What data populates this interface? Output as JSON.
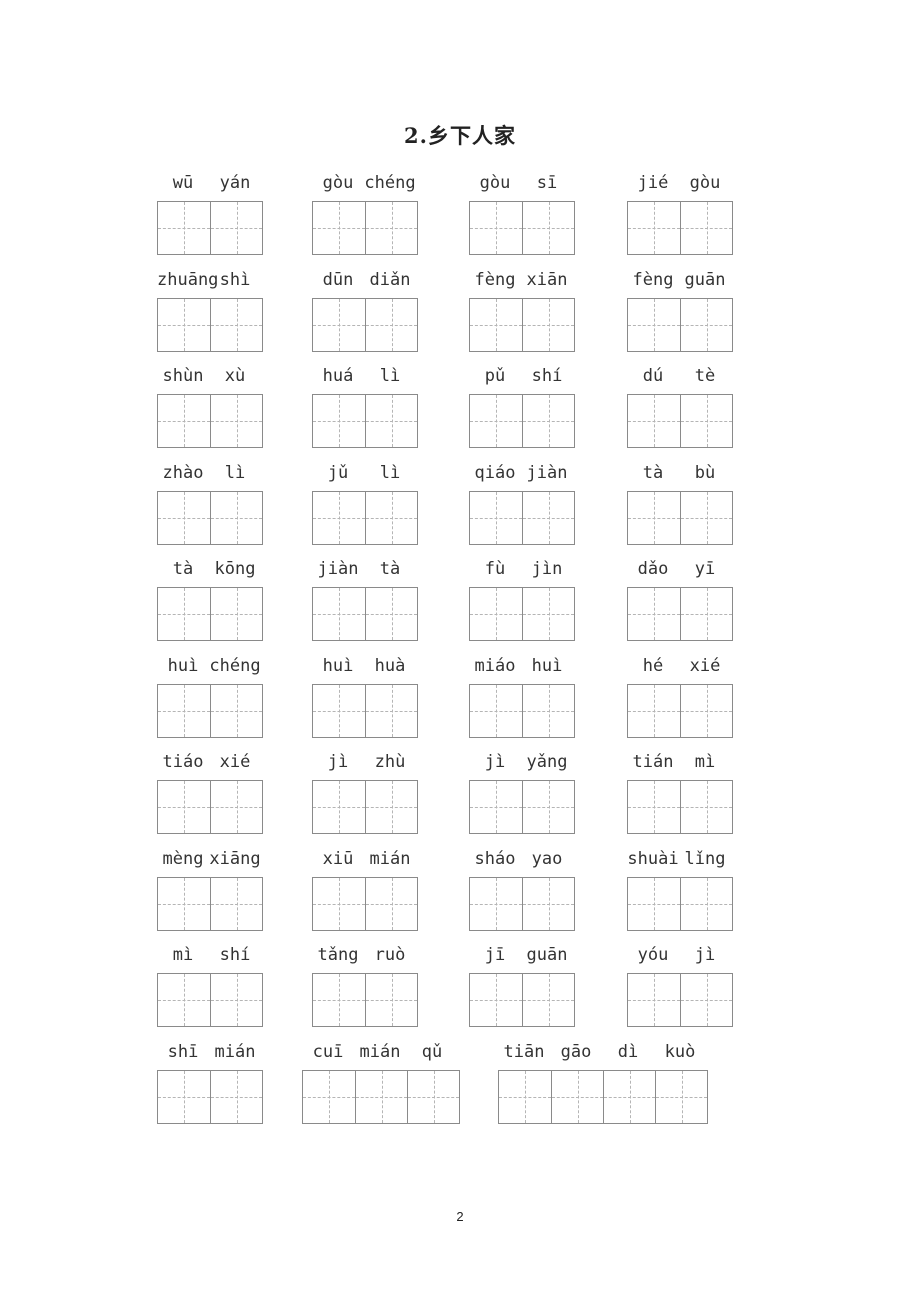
{
  "title": "2.乡下人家",
  "rows": [
    [
      [
        "wū",
        "yán"
      ],
      [
        "gòu",
        "chéng"
      ],
      [
        "gòu",
        "sī"
      ],
      [
        "jié",
        "gòu"
      ]
    ],
    [
      [
        "zhuāng",
        "shì"
      ],
      [
        "dūn",
        "diǎn"
      ],
      [
        "fèng",
        "xiān"
      ],
      [
        "fèng",
        "guān"
      ]
    ],
    [
      [
        "shùn",
        "xù"
      ],
      [
        "huá",
        "lì"
      ],
      [
        "pǔ",
        "shí"
      ],
      [
        "dú",
        "tè"
      ]
    ],
    [
      [
        "zhào",
        "lì"
      ],
      [
        "jǔ",
        "lì"
      ],
      [
        "qiáo",
        "jiàn"
      ],
      [
        "tà",
        "bù"
      ]
    ],
    [
      [
        "tà",
        "kōng"
      ],
      [
        "jiàn",
        "tà"
      ],
      [
        "fù",
        "jìn"
      ],
      [
        "dǎo",
        "yī"
      ]
    ],
    [
      [
        "huì",
        "chéng"
      ],
      [
        "huì",
        "huà"
      ],
      [
        "miáo",
        "huì"
      ],
      [
        "hé",
        "xié"
      ]
    ],
    [
      [
        "tiáo",
        "xié"
      ],
      [
        "jì",
        "zhù"
      ],
      [
        "jì",
        "yǎng"
      ],
      [
        "tián",
        "mì"
      ]
    ],
    [
      [
        "mèng",
        "xiāng"
      ],
      [
        "xiū",
        "mián"
      ],
      [
        "sháo",
        "yao"
      ],
      [
        "shuài",
        "lǐng"
      ]
    ],
    [
      [
        "mì",
        "shí"
      ],
      [
        "tǎng",
        "ruò"
      ],
      [
        "jī",
        "guān"
      ],
      [
        "yóu",
        "jì"
      ]
    ],
    [
      [
        "shī",
        "mián"
      ],
      [
        "cuī",
        "mián",
        "qǔ"
      ],
      [
        "tiān",
        "gāo",
        "dì",
        "kuò"
      ]
    ]
  ],
  "page_number": "2"
}
